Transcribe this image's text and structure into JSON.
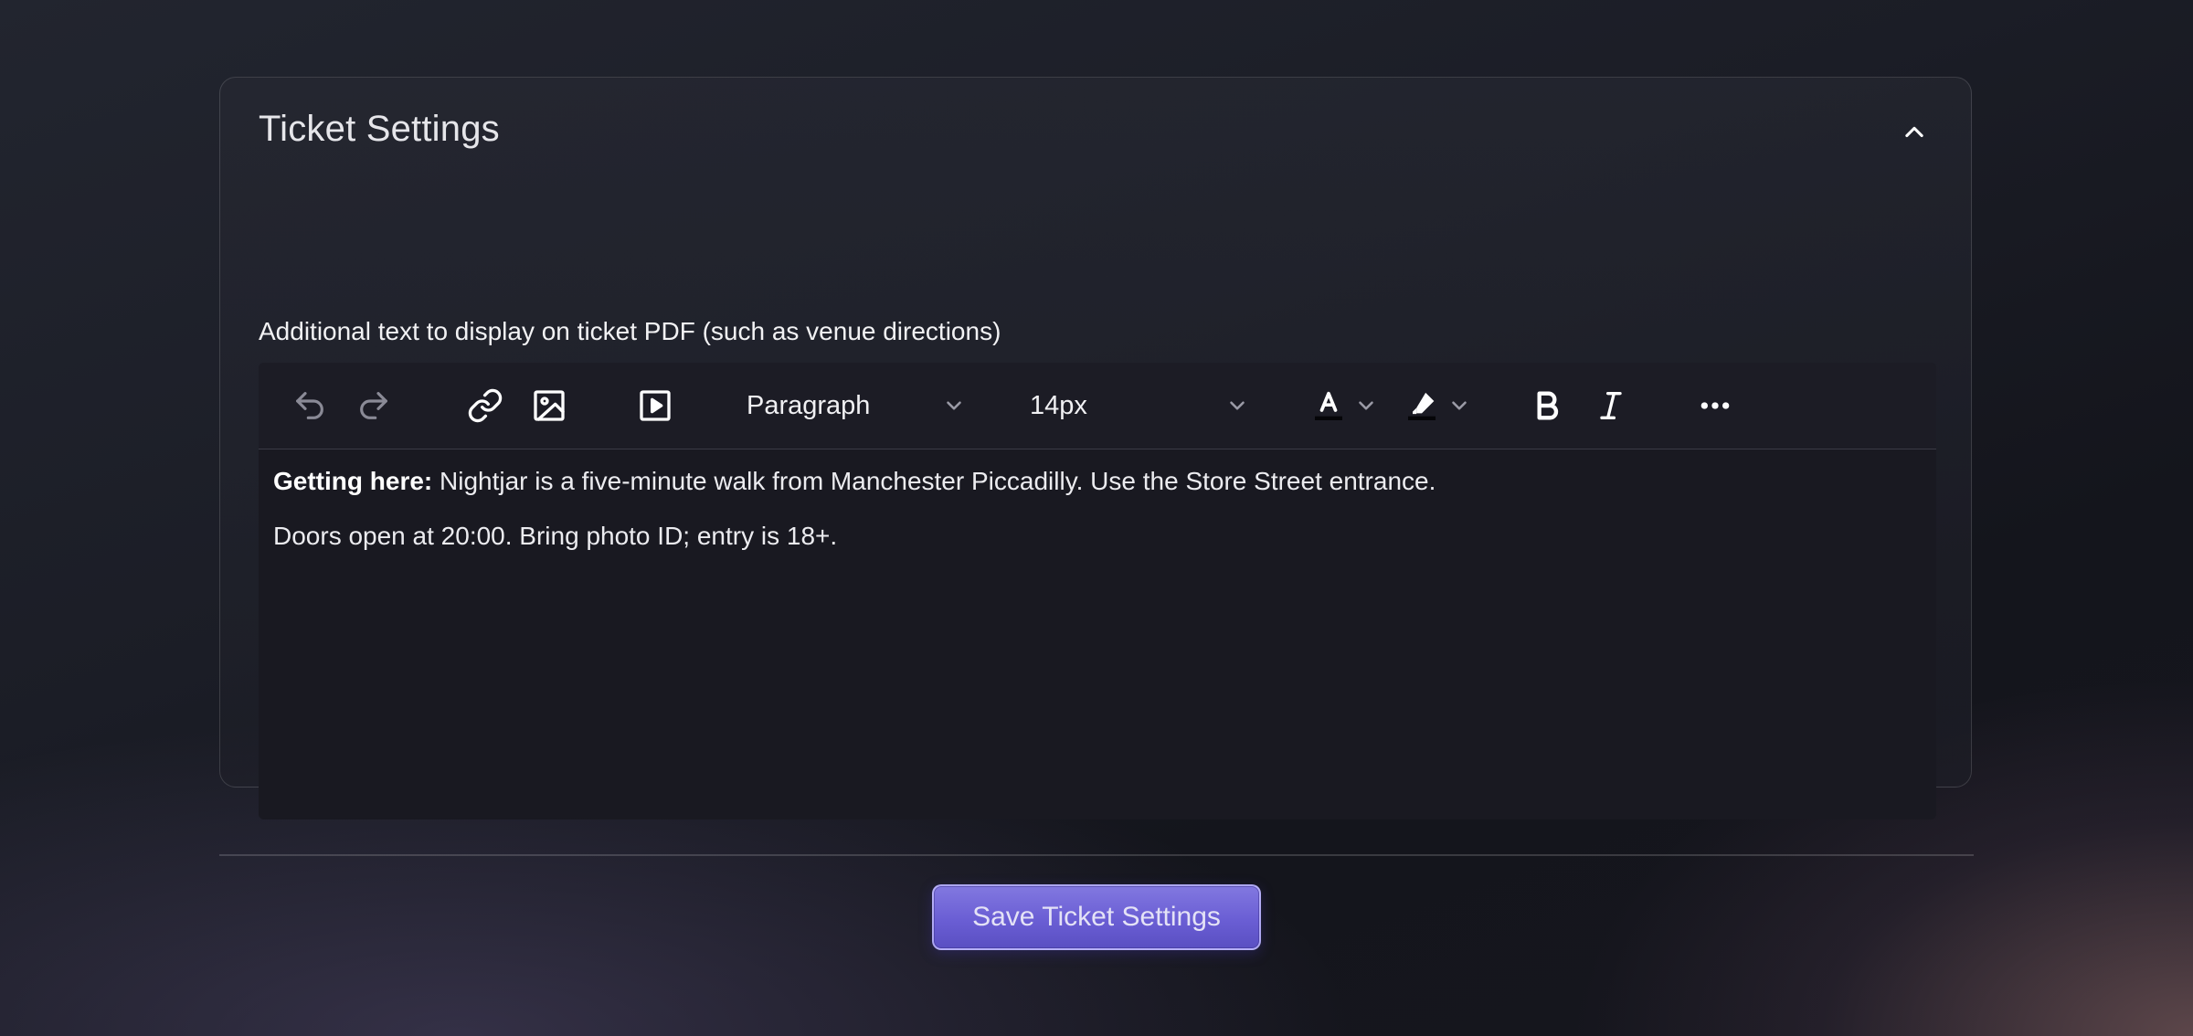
{
  "panel": {
    "title": "Ticket Settings",
    "collapse_icon": "chevron-up-icon"
  },
  "field": {
    "label": "Additional text to display on ticket PDF (such as venue directions)"
  },
  "toolbar": {
    "icons": [
      "undo-icon",
      "redo-icon",
      "link-icon",
      "image-icon",
      "video-icon",
      "text-color-icon",
      "highlight-icon",
      "bold-icon",
      "italic-icon",
      "more-icon"
    ],
    "block_format": "Paragraph",
    "font_size": "14px"
  },
  "content": {
    "line1_bold": "Getting here:",
    "line1_rest": " Nightjar is a five-minute walk from Manchester Piccadilly. Use the Store Street entrance.",
    "line2": "Doors open at 20:00. Bring photo ID; entry is 18+."
  },
  "actions": {
    "save_label": "Save Ticket Settings"
  },
  "colors": {
    "accent": "#6a5ed4",
    "editor_bg": "#191921"
  }
}
